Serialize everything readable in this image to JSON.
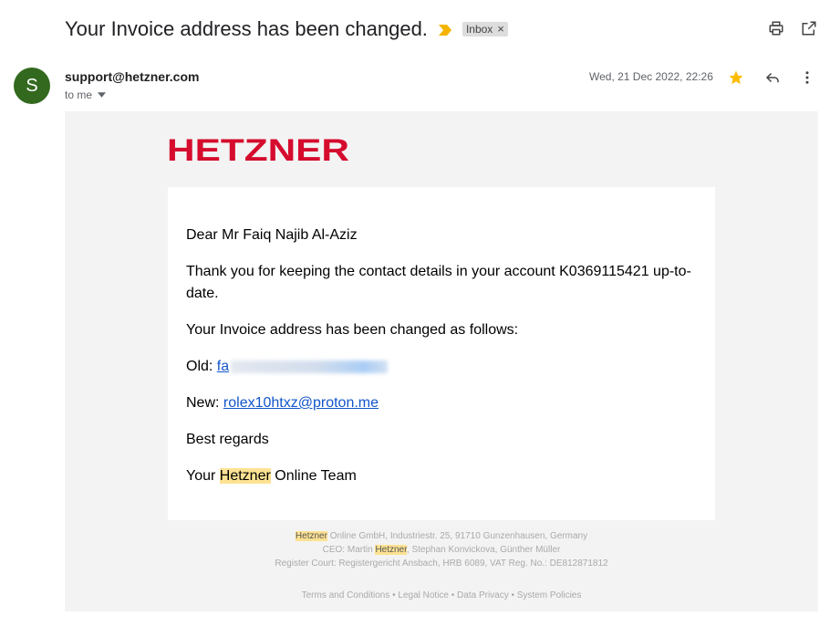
{
  "subject": {
    "title": "Your Invoice address has been changed.",
    "label": "Inbox",
    "label_close": "×"
  },
  "top_icons": [
    "print-icon",
    "open-in-new-window-icon"
  ],
  "sender": {
    "avatar_letter": "S",
    "avatar_color": "#33691e",
    "email": "support@hetzner.com",
    "recipient": "to me",
    "date": "Wed, 21 Dec 2022, 22:26",
    "starred": true,
    "star_color": "#fbbc04"
  },
  "email": {
    "brand": "HETZNER",
    "brand_color": "#d50c2d",
    "greeting": "Dear Mr Faiq Najib Al-Aziz",
    "body_line1": "Thank you for keeping the contact details in your account K0369115421 up-to-",
    "body_line2": "date.",
    "changed_intro": "Your Invoice address has been changed as follows:",
    "old_label": "Old: ",
    "old_value_visible": "fa",
    "new_label": "New: ",
    "new_value": "rolex10htxz@proton.me",
    "closing": "Best regards",
    "signature_prefix": "Your ",
    "signature_highlight": "Hetzner",
    "signature_suffix": " Online Team"
  },
  "footer": {
    "company_highlight": "Hetzner",
    "company_rest": " Online GmbH, Industriestr. 25, 91710 Gunzenhausen, Germany",
    "ceo_prefix": "CEO: Martin ",
    "ceo_highlight": "Hetzner",
    "ceo_rest": ", Stephan Konvickova, Günther Müller",
    "register": "Register Court: Registergericht Ansbach, HRB 6089, VAT Reg. No.: DE812871812",
    "links": [
      "Terms and Conditions",
      "Legal Notice",
      "Data Privacy",
      "System Policies"
    ],
    "separator": " • "
  }
}
